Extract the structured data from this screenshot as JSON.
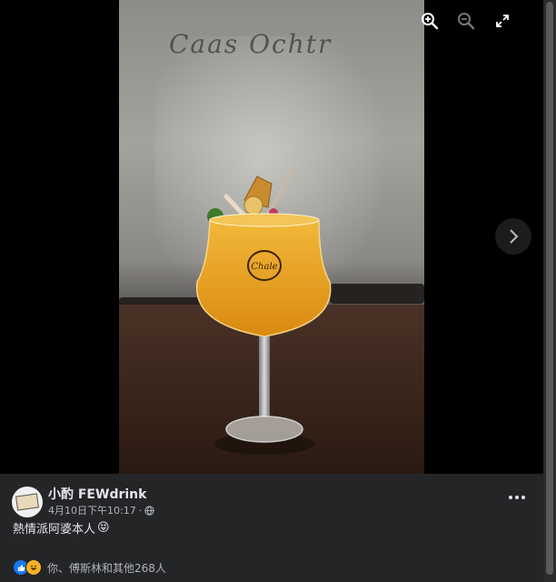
{
  "viewer": {
    "photo_sign_text": "Caas Ochtr",
    "glass_logo_text": "Chale",
    "controls": [
      {
        "name": "zoom-in-icon"
      },
      {
        "name": "zoom-out-icon"
      },
      {
        "name": "fullscreen-icon"
      }
    ],
    "next_icon": "chevron-right-icon"
  },
  "post": {
    "author": "小酌 FEWdrink",
    "timestamp": "4月10日下午10:17",
    "separator": "·",
    "privacy_icon": "globe-icon",
    "caption": "熱情派阿婆本人",
    "caption_emoji": "😝",
    "reaction_icons": [
      "like-icon",
      "haha-icon"
    ],
    "reactions_text": "你、傅斯林和其他268人"
  },
  "colors": {
    "post_bg": "#242526",
    "text_primary": "#e4e6eb",
    "text_secondary": "#b0b3b8",
    "like_blue": "#1877f2",
    "haha_yellow": "#f7b125"
  }
}
